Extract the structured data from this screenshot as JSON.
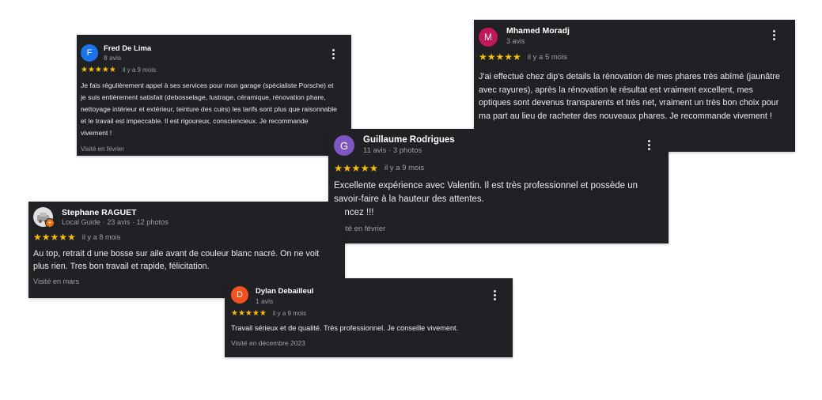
{
  "reviews": [
    {
      "initial": "F",
      "avatar_color": "#1a73e8",
      "name": "Fred De Lima",
      "meta": "8 avis",
      "stars": "★★★★★",
      "when": "il y a 9 mois",
      "text": "Je fais régulièrement appel à ses services pour mon garage (spécialiste Porsche) et je suis entièrement satisfait (debosselage, lustrage, céramique, rénovation phare, nettoyage intérieur et extérieur, teinture des cuirs) les tarifs sont plus que raisonnable et le travail est impeccable. Il est rigoureux, consciencieux. Je recommande vivement !",
      "visited": "Visité en février"
    },
    {
      "initial": "M",
      "avatar_color": "#c2185b",
      "name": "Mhamed Moradj",
      "meta": "3 avis",
      "stars": "★★★★★",
      "when": "il y a 5 mois",
      "text": "J'ai effectué chez dip's details la rénovation de mes phares très abîmé (jaunâtre avec rayures), après la rénovation le résultat est vraiment excellent, mes optiques sont devenus transparents et très net, vraiment un très bon choix pour ma part au lieu de racheter des nouveaux phares. Je recommande vivement !"
    },
    {
      "initial": "G",
      "avatar_color": "#7e57c2",
      "name": "Guillaume Rodrigues",
      "meta": "11 avis · 3 photos",
      "stars": "★★★★★",
      "when": "il y a 9 mois",
      "text_line1": "Excellente expérience avec Valentin. Il est très professionnel et possède un savoir-faire à la hauteur des attentes.",
      "text_line2": "Foncez !!!",
      "visited": "Visité en février"
    },
    {
      "initial": "",
      "avatar_color": "#e0e0e0",
      "name": "Stephane RAGUET",
      "meta": "Local Guide · 23 avis · 12 photos",
      "stars": "★★★★★",
      "when": "il y a 8 mois",
      "text": "Au top, retrait d une bosse sur aile avant de couleur blanc nacré. On ne voit plus rien. Tres bon travail et rapide, félicitation.",
      "visited": "Visité en mars"
    },
    {
      "initial": "D",
      "avatar_color": "#f4511e",
      "name": "Dylan Debailleul",
      "meta": "1 avis",
      "stars": "★★★★★",
      "when": "il y a 9 mois",
      "text": "Travail sérieux et de qualité. Très professionnel. Je conseille vivement.",
      "visited": "Visité en décembre 2023"
    }
  ],
  "colors": {
    "card_bg": "#202124",
    "star": "#fbbc04",
    "secondary_text": "#9aa0a6",
    "local_guide_badge": "#e8710a"
  }
}
